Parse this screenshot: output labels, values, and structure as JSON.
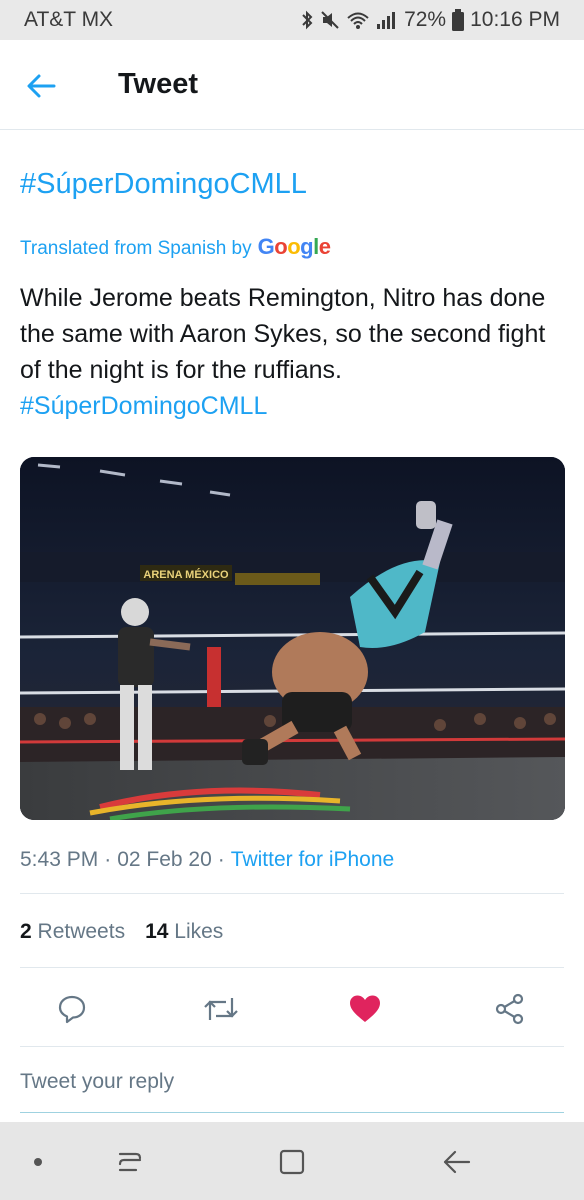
{
  "status_bar": {
    "carrier": "AT&T MX",
    "battery": "72%",
    "time": "10:16 PM"
  },
  "header": {
    "title": "Tweet"
  },
  "tweet": {
    "hashtag_title": "#SúperDomingoCMLL",
    "translated_prefix": "Translated from Spanish by",
    "translator": "Google",
    "text": "While Jerome beats Remington, Nitro has done the same with Aaron Sykes, so the second fight of the night is for the ruffians. ",
    "text_hashtag": "#SúperDomingoCMLL",
    "media": {
      "banner": "ARENA MÉXICO"
    },
    "time": "5:43 PM",
    "date": "02 Feb 20",
    "source": "Twitter for iPhone",
    "retweets_count": "2",
    "retweets_label": "Retweets",
    "likes_count": "14",
    "likes_label": "Likes",
    "liked": true
  },
  "reply": {
    "placeholder": "Tweet your reply"
  },
  "colors": {
    "accent": "#1da1f2",
    "like": "#e0245e",
    "muted": "#657786"
  },
  "icons": [
    "back-arrow-icon",
    "reply-icon",
    "retweet-icon",
    "heart-icon",
    "share-icon",
    "recent-apps-icon",
    "home-icon",
    "nav-back-icon"
  ]
}
